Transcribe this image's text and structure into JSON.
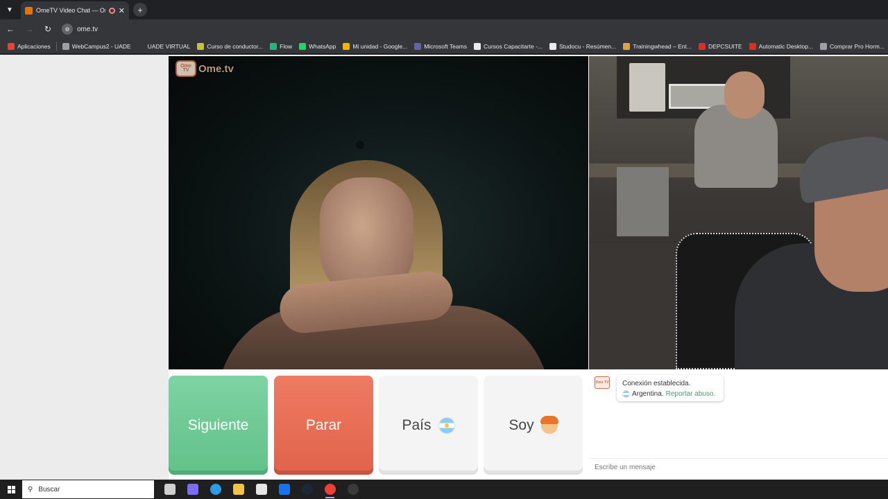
{
  "browser": {
    "tab": {
      "title": "OmeTV Video Chat — Ome",
      "close_glyph": "✕"
    },
    "new_tab_glyph": "+",
    "url": "ome.tv",
    "bookmarks": [
      {
        "label": "Aplicaciones",
        "color": "#ea4335"
      },
      {
        "label": "WebCampus2 - UADE",
        "color": "#9aa0a6"
      },
      {
        "label": "UADE VIRTUAL",
        "color": "#35363a"
      },
      {
        "label": "Curso de conductor...",
        "color": "#c6c23a"
      },
      {
        "label": "Flow",
        "color": "#26b47f"
      },
      {
        "label": "WhatsApp",
        "color": "#25d366"
      },
      {
        "label": "Mi unidad - Google...",
        "color": "#f4b400"
      },
      {
        "label": "Microsoft Teams",
        "color": "#6264a7"
      },
      {
        "label": "Cursos Capacitarte -...",
        "color": "#e8eaed"
      },
      {
        "label": "Studocu - Resúmen...",
        "color": "#e8eaed"
      },
      {
        "label": "Trainingwhead – Ent...",
        "color": "#d9a441"
      },
      {
        "label": "DEPCSUITE",
        "color": "#d93025"
      },
      {
        "label": "Automatic Desktop...",
        "color": "#d93025"
      },
      {
        "label": "Comprar Pro Horm...",
        "color": "#9aa0a6"
      }
    ]
  },
  "ome": {
    "logo_small": "Ome TV",
    "logo_word": "Ome.tv",
    "buttons": {
      "next": "Siguiente",
      "stop": "Parar",
      "country": "País",
      "gender": "Soy"
    },
    "chat": {
      "status": "Conexión establecida.",
      "country": "Argentina.",
      "report": "Reportar abuso.",
      "placeholder": "Escribe un mensaje"
    },
    "colors": {
      "next": "#6fca95",
      "stop": "#e76e55",
      "neutral": "#f4f4f4"
    }
  },
  "taskbar": {
    "search_placeholder": "Buscar",
    "search_icon": "search-icon",
    "apps": [
      {
        "name": "task-view-icon",
        "color": "#cfcfcf"
      },
      {
        "name": "copilot-icon",
        "color": "#7c6cf0"
      },
      {
        "name": "edge-icon",
        "color": "#2b9ce6"
      },
      {
        "name": "file-explorer-icon",
        "color": "#f2c34a"
      },
      {
        "name": "store-icon",
        "color": "#e6e6e6"
      },
      {
        "name": "outlook-icon",
        "color": "#1a73e8"
      },
      {
        "name": "steam-icon",
        "color": "#1b2838"
      },
      {
        "name": "chrome-icon",
        "color": "#ea4335"
      },
      {
        "name": "obs-icon",
        "color": "#3a3a3a"
      }
    ]
  }
}
